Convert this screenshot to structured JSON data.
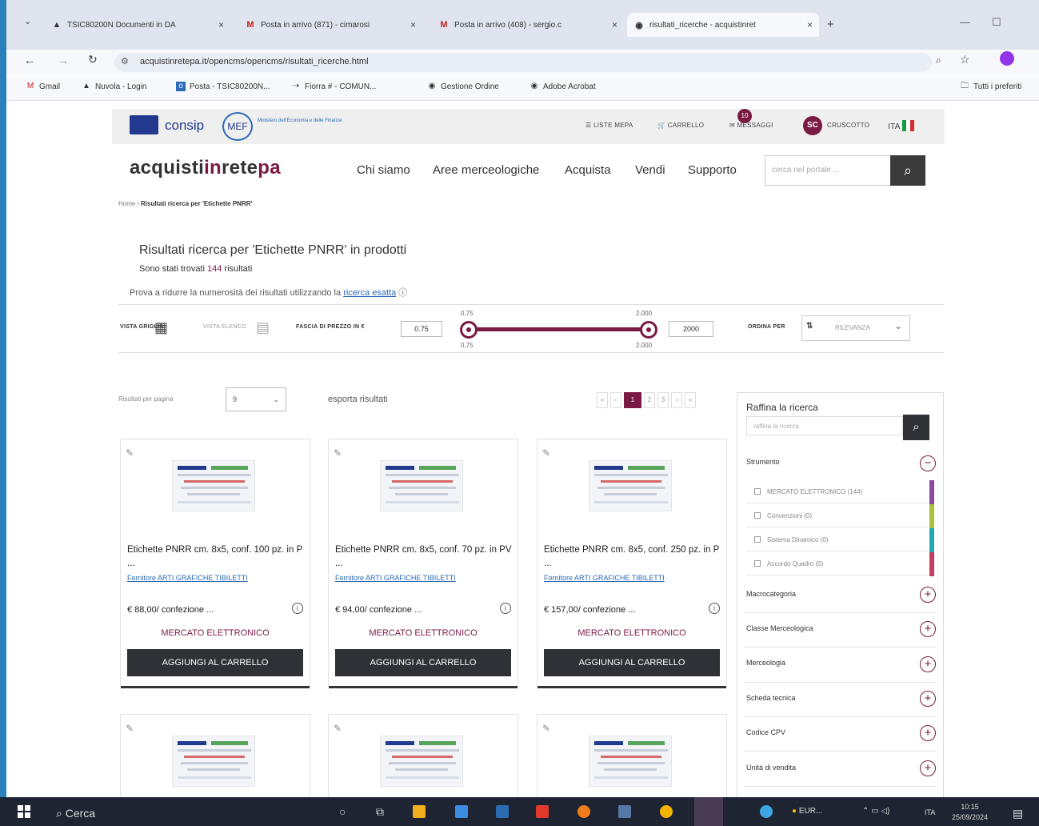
{
  "browser": {
    "tabs": [
      {
        "label": "TSIC80200N Documenti in DA"
      },
      {
        "label": "Posta in arrivo (871) - cimarosi"
      },
      {
        "label": "Posta in arrivo (408) - sergio.c"
      },
      {
        "label": "risultati_ricerche - acquistinret"
      }
    ],
    "url": "acquistinretepa.it/opencms/opencms/risultati_ricerche.html",
    "bookmarks": [
      "Gmail",
      "Nuvola - Login",
      "Posta - TSIC80200N...",
      "Fiorra # - COMUN...",
      "Gestione Ordine",
      "Adobe Acrobat"
    ],
    "all_bookmarks": "Tutti i preferiti"
  },
  "site": {
    "consip": "consip",
    "mef": "MEF",
    "mef_sub": "Ministero dell'Economia e delle Finanze",
    "util": {
      "liste": "LISTE MEPA",
      "carrello": "CARRELLO",
      "messaggi": "MESSAGGI",
      "messaggi_count": "10",
      "avatar": "SC",
      "cruscotto": "CRUSCOTTO",
      "lang": "ITA"
    },
    "logo_a": "acquisti",
    "logo_b": "in",
    "logo_c": "rete",
    "logo_d": "pa",
    "nav": [
      "Chi siamo",
      "Aree merceologiche",
      "Acquista",
      "Vendi",
      "Supporto"
    ],
    "search_placeholder": "cerca nel portale ...",
    "breadcrumb_home": "Home",
    "breadcrumb_current": "Risultati ricerca per 'Etichette PNRR'"
  },
  "results": {
    "title": "Risultati ricerca per 'Etichette PNRR' in prodotti",
    "found_a": "Sono stati trovati",
    "found_count": "144",
    "found_b": "risultati",
    "hint": "Prova a ridurre la numerosità dei risultati utilizzando la",
    "hint_link": "ricerca esatta"
  },
  "filters": {
    "vista_griglia": "VISTA GRIGLIA",
    "vista_elenco": "VISTA ELENCO",
    "fascia": "FASCIA DI PREZZO IN €",
    "min": "0.75",
    "max": "2000",
    "min_label": "0,75",
    "max_label": "2.000",
    "ordina": "ORDINA PER",
    "ordina_value": "RILEVANZA",
    "per_page_label": "Risultati per pagina",
    "per_page_value": "9",
    "export": "esporta risultati",
    "pages": [
      "«",
      "‹",
      "1",
      "2",
      "3",
      "›",
      "»"
    ]
  },
  "products": [
    {
      "title": "Etichette PNRR cm. 8x5, conf. 100 pz. in P ...",
      "supplier": "Fornitore ARTI GRAFICHE TIBILETTI",
      "price": "€ 88,00/ confezione ...",
      "market": "MERCATO ELETTRONICO",
      "add": "AGGIUNGI AL CARRELLO"
    },
    {
      "title": "Etichette PNRR cm. 8x5, conf. 70 pz. in PV ...",
      "supplier": "Fornitore ARTI GRAFICHE TIBILETTI",
      "price": "€ 94,00/ confezione ...",
      "market": "MERCATO ELETTRONICO",
      "add": "AGGIUNGI AL CARRELLO"
    },
    {
      "title": "Etichette PNRR cm. 8x5, conf. 250 pz. in P ...",
      "supplier": "Fornitore ARTI GRAFICHE TIBILETTI",
      "price": "€ 157,00/ confezione ...",
      "market": "MERCATO ELETTRONICO",
      "add": "AGGIUNGI AL CARRELLO"
    }
  ],
  "sidebar": {
    "title": "Raffina la ricerca",
    "placeholder": "raffina la ricerca",
    "strumento": "Strumento",
    "strumento_items": [
      "MERCATO ELETTRONICO (144)",
      "Convenzioni (0)",
      "Sistema Dinamico (0)",
      "Accordo Quadro (0)"
    ],
    "sections": [
      "Macrocategoria",
      "Classe Merceologica",
      "Merceologia",
      "Scheda tecnica",
      "Codice CPV",
      "Unità di vendita"
    ]
  },
  "taskbar": {
    "search": "Cerca",
    "tray": "EUR...",
    "lang": "ITA",
    "time": "10:15",
    "date": "25/09/2024"
  }
}
